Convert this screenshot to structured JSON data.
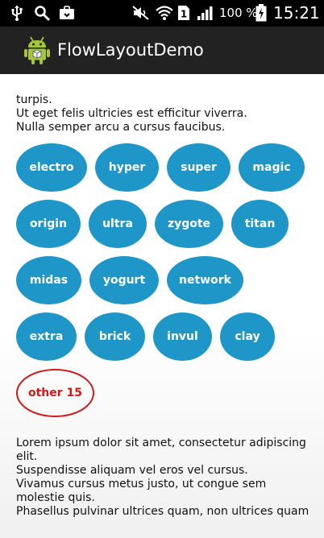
{
  "status_bar": {
    "battery_percent": "100 %",
    "time": "15:21",
    "icons": [
      "usb-icon",
      "search-icon",
      "briefcase-icon",
      "mute-icon",
      "wifi-icon",
      "sim-icon",
      "signal-icon",
      "battery-icon"
    ]
  },
  "action_bar": {
    "title": "FlowLayoutDemo"
  },
  "top_text": [
    "turpis.",
    "Ut eget felis ultricies est efficitur viverra.",
    "Nulla semper arcu a cursus faucibus."
  ],
  "tags": [
    "electro",
    "hyper",
    "super",
    "magic",
    "origin",
    "ultra",
    "zygote",
    "titan",
    "midas",
    "yogurt",
    "network",
    "extra",
    "brick",
    "invul",
    "clay"
  ],
  "other_tag": "other 15",
  "bottom_text": [
    "Lorem ipsum dolor sit amet, consectetur adipiscing elit.",
    "Suspendisse aliquam vel eros vel cursus.",
    "Vivamus cursus metus justo, ut congue sem molestie quis.",
    "Phasellus pulvinar ultrices quam, non ultrices quam"
  ],
  "colors": {
    "tag_fill": "#1e96c8",
    "other_border": "#cc1a1a",
    "action_bar": "#222222",
    "android_green": "#a4c639"
  }
}
